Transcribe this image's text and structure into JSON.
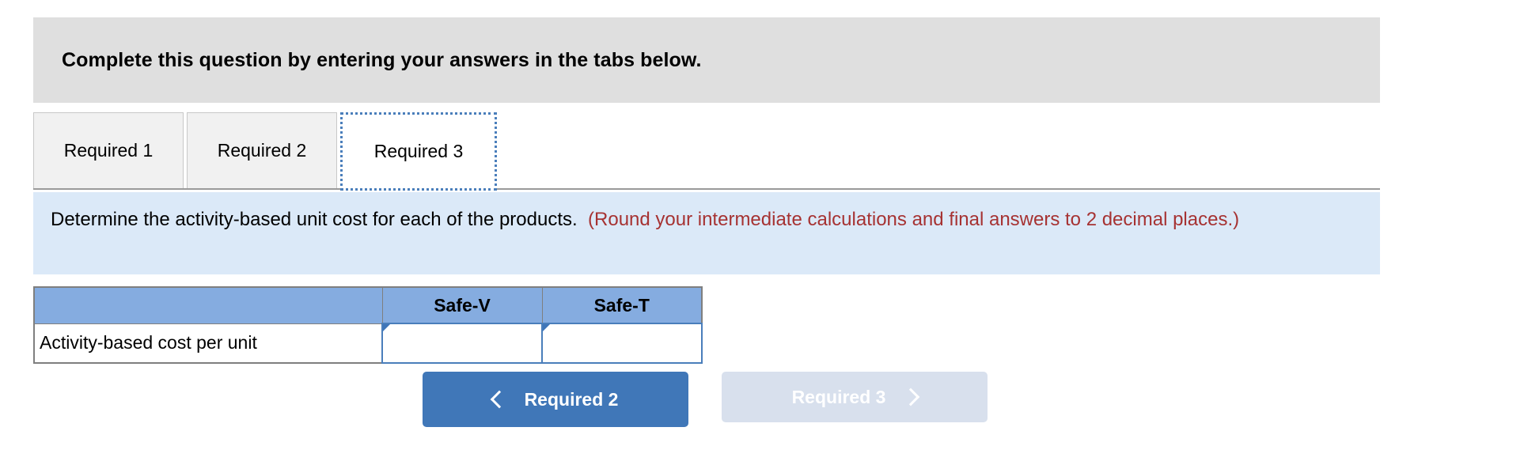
{
  "header": {
    "title": "Complete this question by entering your answers in the tabs below."
  },
  "tabs": [
    {
      "label": "Required 1",
      "active": false
    },
    {
      "label": "Required 2",
      "active": false
    },
    {
      "label": "Required 3",
      "active": true
    }
  ],
  "instruction": {
    "main": "Determine the activity-based unit cost for each of the products.",
    "note": "(Round your intermediate calculations and final answers to 2 decimal places.)"
  },
  "table": {
    "columns": [
      "",
      "Safe-V",
      "Safe-T"
    ],
    "rows": [
      {
        "label": "Activity-based cost per unit",
        "cells": [
          {
            "value": "",
            "placeholder": ""
          },
          {
            "value": "",
            "placeholder": ""
          }
        ]
      }
    ]
  },
  "navigation": {
    "prev": {
      "label": "Required 2",
      "icon": "chevron-left-icon",
      "enabled": true
    },
    "next": {
      "label": "Required 3",
      "icon": "chevron-right-icon",
      "enabled": false
    }
  },
  "colors": {
    "header_band": "#DFDFDF",
    "instruction_band": "#DBE9F8",
    "note_text": "#A63232",
    "table_header": "#85ACE0",
    "input_border": "#4A7EBB",
    "primary_button": "#4077B8",
    "disabled_button": "#D8E0ED",
    "tab_inactive": "#F1F1F1",
    "tab_active": "#FFFFFF"
  }
}
